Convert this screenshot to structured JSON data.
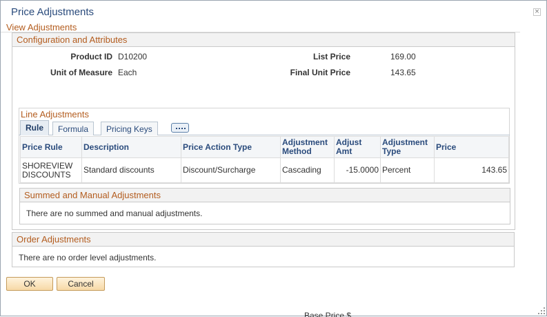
{
  "dialog": {
    "title": "Price Adjustments",
    "close_label": "×"
  },
  "view_adjustments": {
    "heading": "View Adjustments"
  },
  "config": {
    "title": "Configuration and Attributes",
    "fields": {
      "product_id": {
        "label": "Product ID",
        "value": "D10200"
      },
      "unit_of_measure": {
        "label": "Unit of Measure",
        "value": "Each"
      },
      "list_price": {
        "label": "List Price",
        "value": "169.00"
      },
      "final_unit_price": {
        "label": "Final Unit Price",
        "value": "143.65"
      }
    }
  },
  "line_adjustments": {
    "title": "Line Adjustments",
    "tabs": [
      {
        "label": "Rule",
        "active": true
      },
      {
        "label": "Formula",
        "active": false
      },
      {
        "label": "Pricing Keys",
        "active": false
      }
    ],
    "columns": [
      "Price Rule",
      "Description",
      "Price Action Type",
      "Adjustment Method",
      "Adjust Amt",
      "Adjustment Type",
      "Price"
    ],
    "rows": [
      {
        "price_rule": "SHOREVIEW DISCOUNTS",
        "description": "Standard discounts",
        "price_action_type": "Discount/Surcharge",
        "adjustment_method": "Cascading",
        "adjust_amt": "-15.0000",
        "adjustment_type": "Percent",
        "price": "143.65"
      }
    ]
  },
  "summed": {
    "title": "Summed and Manual Adjustments",
    "message": "There are no summed and manual adjustments."
  },
  "order": {
    "title": "Order Adjustments",
    "message": "There are no order level adjustments."
  },
  "buttons": {
    "ok": "OK",
    "cancel": "Cancel"
  },
  "background_text": "Base Price $"
}
